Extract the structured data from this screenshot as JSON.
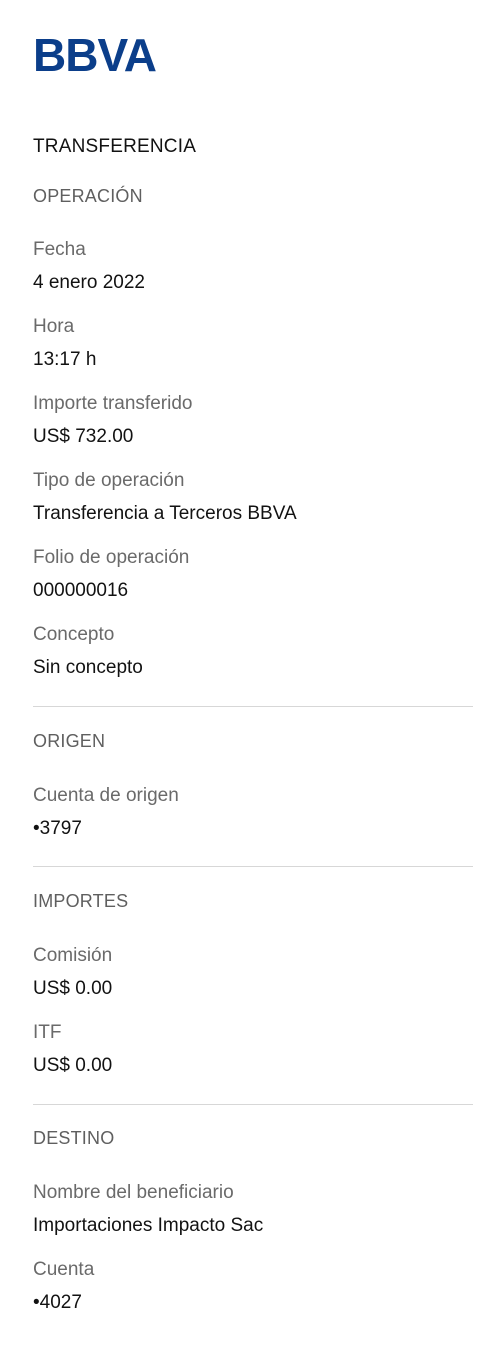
{
  "brand": {
    "logo_text": "BBVA",
    "logo_color": "#0b3e8a"
  },
  "title": "TRANSFERENCIA",
  "operacion": {
    "section_title": "OPERACIÓN",
    "fecha_label": "Fecha",
    "fecha_value": "4 enero 2022",
    "hora_label": "Hora",
    "hora_value": "13:17 h",
    "importe_label": "Importe transferido",
    "importe_value": "US$ 732.00",
    "tipo_label": "Tipo de operación",
    "tipo_value": "Transferencia a Terceros BBVA",
    "folio_label": "Folio de operación",
    "folio_value": "000000016",
    "concepto_label": "Concepto",
    "concepto_value": "Sin concepto"
  },
  "origen": {
    "section_title": "ORIGEN",
    "cuenta_label": "Cuenta de origen",
    "cuenta_value": "•3797"
  },
  "importes": {
    "section_title": "IMPORTES",
    "comision_label": "Comisión",
    "comision_value": "US$ 0.00",
    "itf_label": "ITF",
    "itf_value": "US$ 0.00"
  },
  "destino": {
    "section_title": "DESTINO",
    "beneficiario_label": "Nombre del beneficiario",
    "beneficiario_value": "Importaciones Impacto Sac",
    "cuenta_label": "Cuenta",
    "cuenta_value": "•4027"
  }
}
